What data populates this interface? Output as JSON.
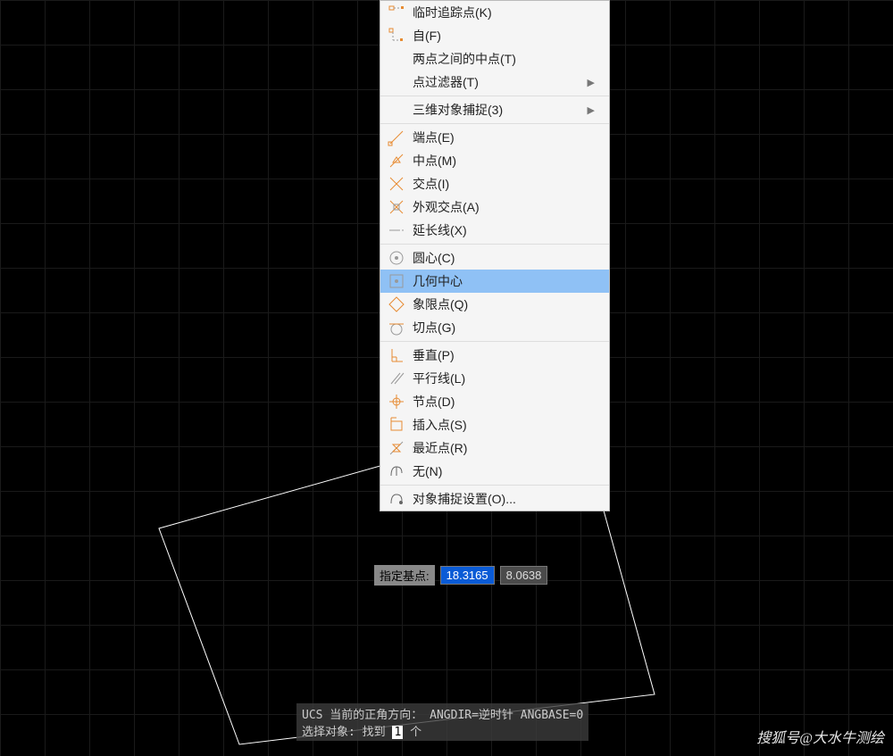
{
  "menu": {
    "sections": [
      {
        "items": [
          {
            "icon": "snap-track-icon",
            "label": "临时追踪点(K)",
            "arrow": false
          },
          {
            "icon": "snap-from-icon",
            "label": "自(F)",
            "arrow": false
          },
          {
            "icon": null,
            "label": "两点之间的中点(T)",
            "arrow": false
          },
          {
            "icon": null,
            "label": "点过滤器(T)",
            "arrow": true
          }
        ]
      },
      {
        "items": [
          {
            "icon": null,
            "label": "三维对象捕捉(3)",
            "arrow": true
          }
        ]
      },
      {
        "items": [
          {
            "icon": "snap-endpoint-icon",
            "label": "端点(E)",
            "arrow": false
          },
          {
            "icon": "snap-midpoint-icon",
            "label": "中点(M)",
            "arrow": false
          },
          {
            "icon": "snap-intersection-icon",
            "label": "交点(I)",
            "arrow": false
          },
          {
            "icon": "snap-apparent-int-icon",
            "label": "外观交点(A)",
            "arrow": false
          },
          {
            "icon": "snap-extension-icon",
            "label": "延长线(X)",
            "arrow": false
          }
        ]
      },
      {
        "items": [
          {
            "icon": "snap-center-icon",
            "label": "圆心(C)",
            "arrow": false
          },
          {
            "icon": "snap-geometric-center-icon",
            "label": "几何中心",
            "arrow": false,
            "hover": true
          },
          {
            "icon": "snap-quadrant-icon",
            "label": "象限点(Q)",
            "arrow": false
          },
          {
            "icon": "snap-tangent-icon",
            "label": "切点(G)",
            "arrow": false
          }
        ]
      },
      {
        "items": [
          {
            "icon": "snap-perpendicular-icon",
            "label": "垂直(P)",
            "arrow": false
          },
          {
            "icon": "snap-parallel-icon",
            "label": "平行线(L)",
            "arrow": false
          },
          {
            "icon": "snap-node-icon",
            "label": "节点(D)",
            "arrow": false
          },
          {
            "icon": "snap-insert-icon",
            "label": "插入点(S)",
            "arrow": false
          },
          {
            "icon": "snap-nearest-icon",
            "label": "最近点(R)",
            "arrow": false
          },
          {
            "icon": "snap-none-icon",
            "label": "无(N)",
            "arrow": false
          }
        ]
      },
      {
        "items": [
          {
            "icon": "snap-settings-icon",
            "label": "对象捕捉设置(O)...",
            "arrow": false
          }
        ]
      }
    ]
  },
  "dynamic_input": {
    "label": "指定基点:",
    "x": "18.3165",
    "y": "8.0638"
  },
  "command_line": {
    "line1_pre": "UCS 当前的正角方向：  ANGDIR=逆时针  ANGBASE=0",
    "line2_pre": "选择对象: 找到 ",
    "line2_hl": "1",
    "line2_post": " 个"
  },
  "watermark": "搜狐号@大水牛测绘"
}
